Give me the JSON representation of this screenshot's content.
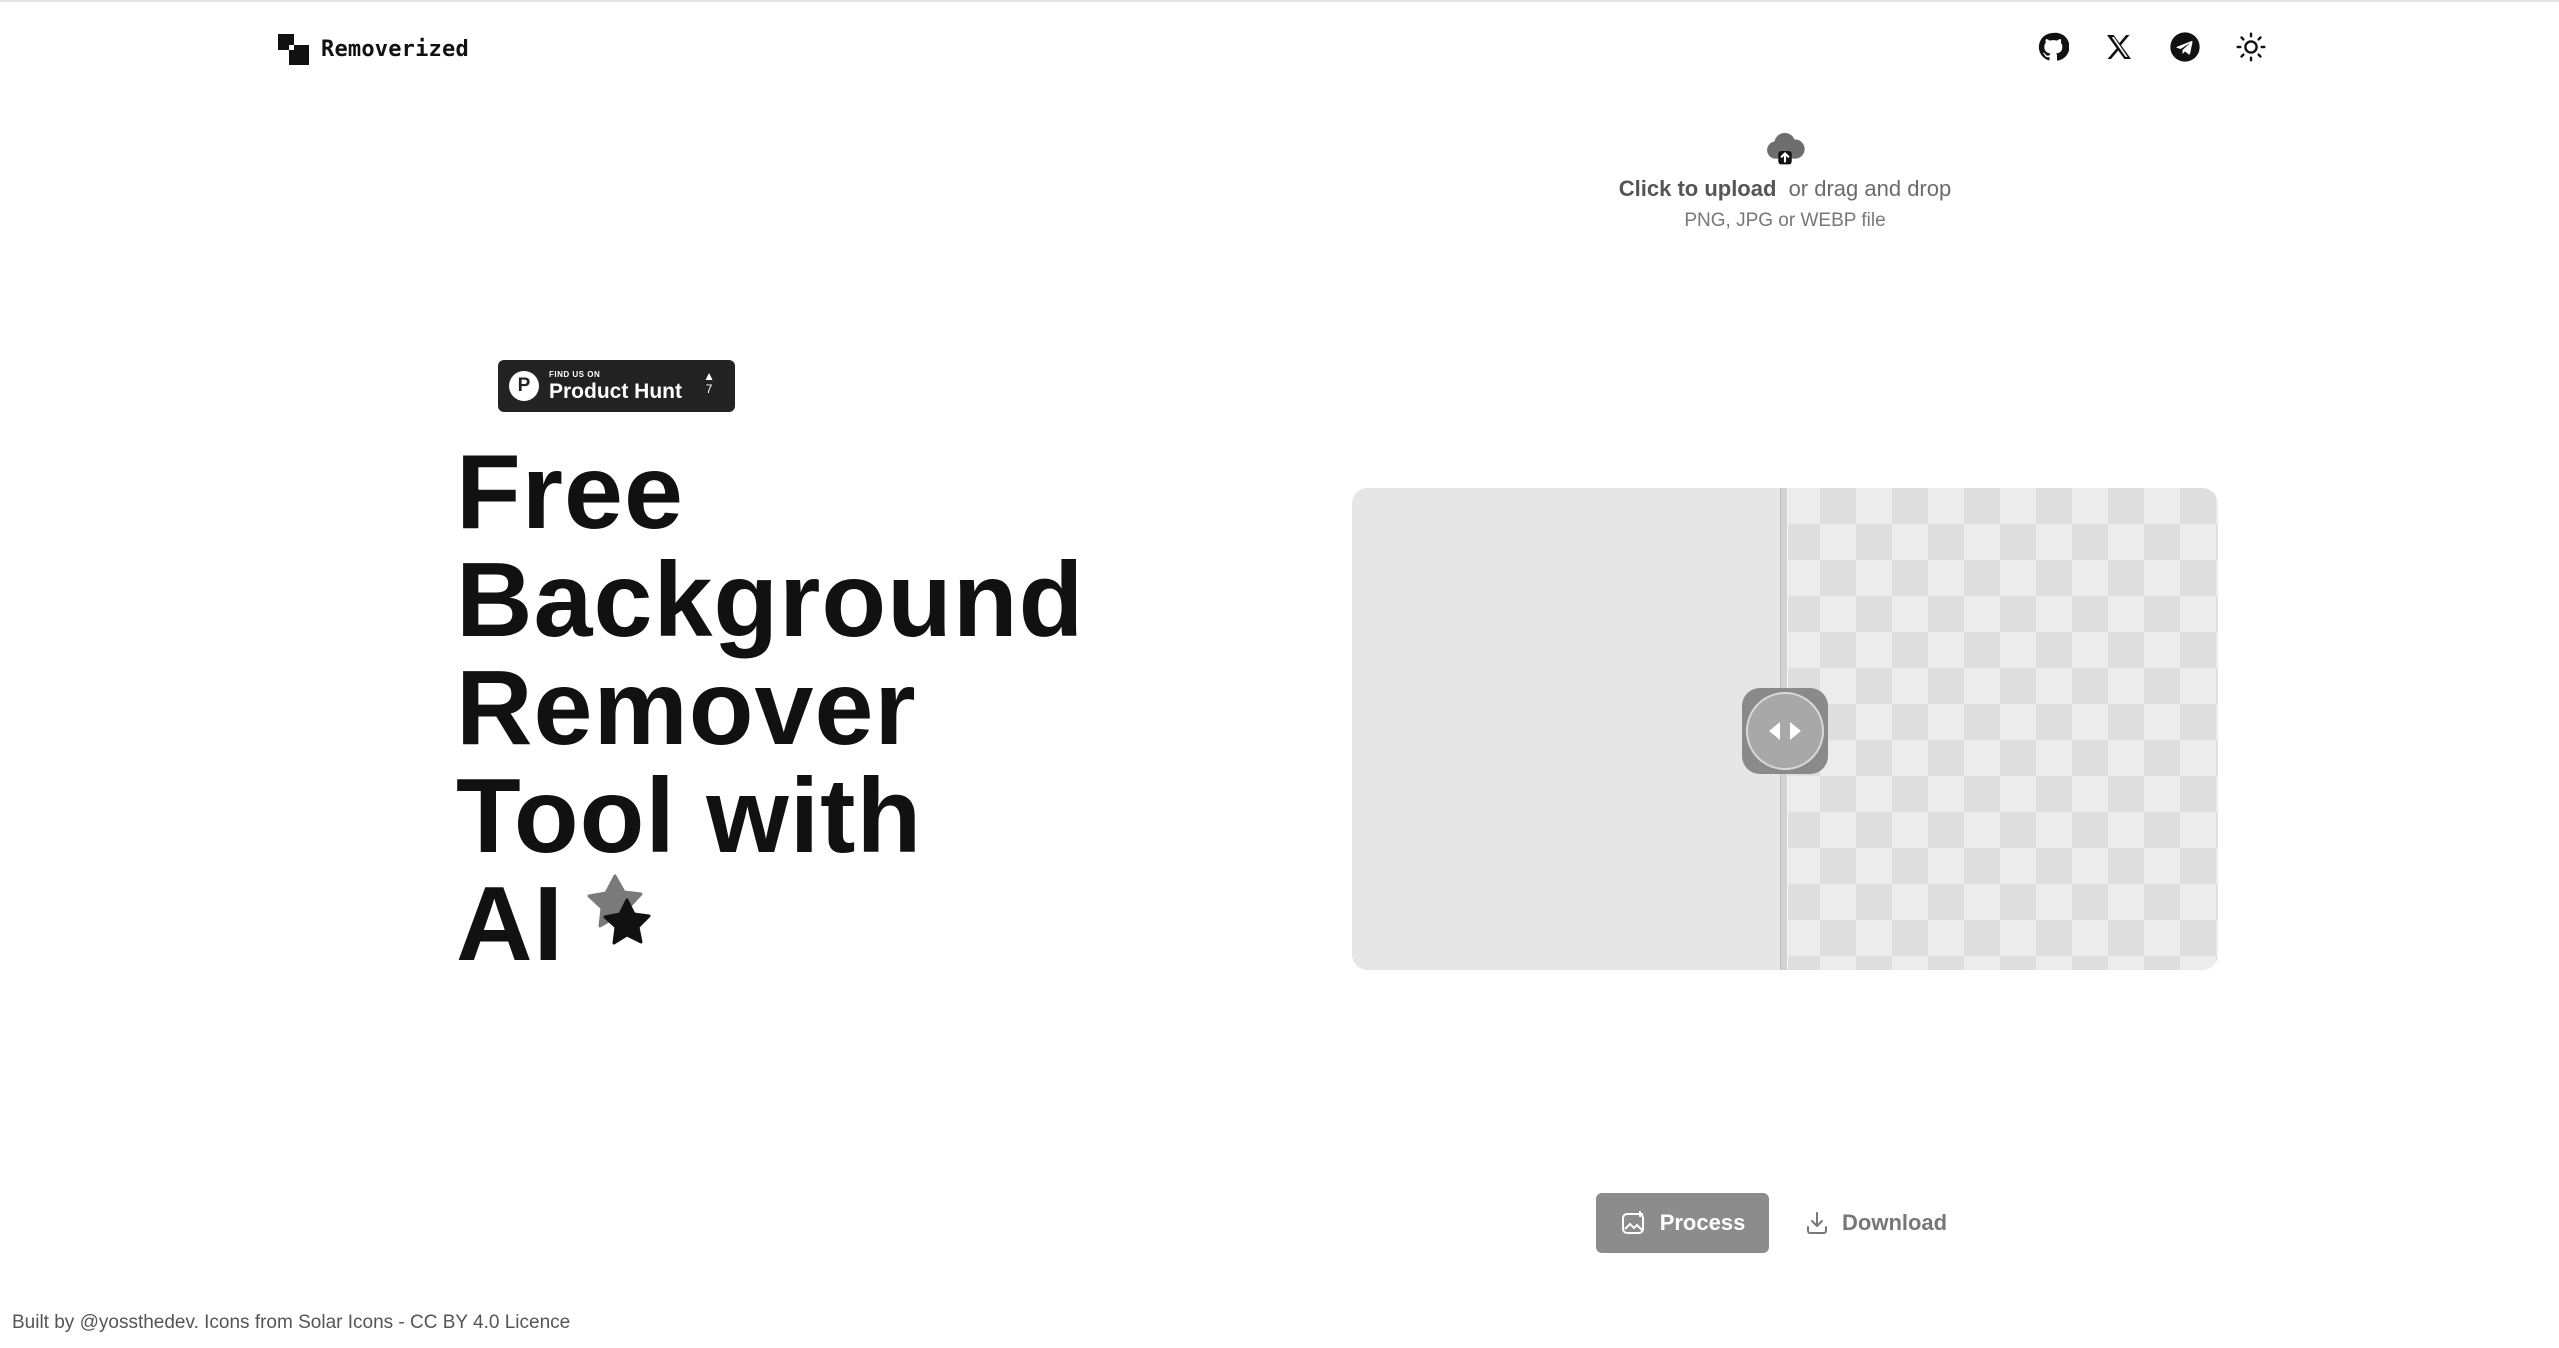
{
  "header": {
    "brand": "Removerized",
    "icons": [
      "github-icon",
      "x-twitter-icon",
      "telegram-icon",
      "sun-theme-icon"
    ]
  },
  "upload": {
    "click_label": "Click to upload",
    "drag_label": "or drag and drop",
    "formats": "PNG, JPG or WEBP file"
  },
  "product_hunt": {
    "small": "FIND US ON",
    "big": "Product Hunt",
    "votes": "7"
  },
  "hero": {
    "lines": [
      "Free",
      "Background",
      "Remover",
      "Tool with",
      "AI"
    ]
  },
  "actions": {
    "process_label": "Process",
    "download_label": "Download"
  },
  "footer": {
    "text": "Built by @yossthedev. Icons from Solar Icons - CC BY 4.0 Licence"
  },
  "colors": {
    "text": "#111111",
    "process_bg": "#8c8c8c",
    "muted": "#777777"
  }
}
